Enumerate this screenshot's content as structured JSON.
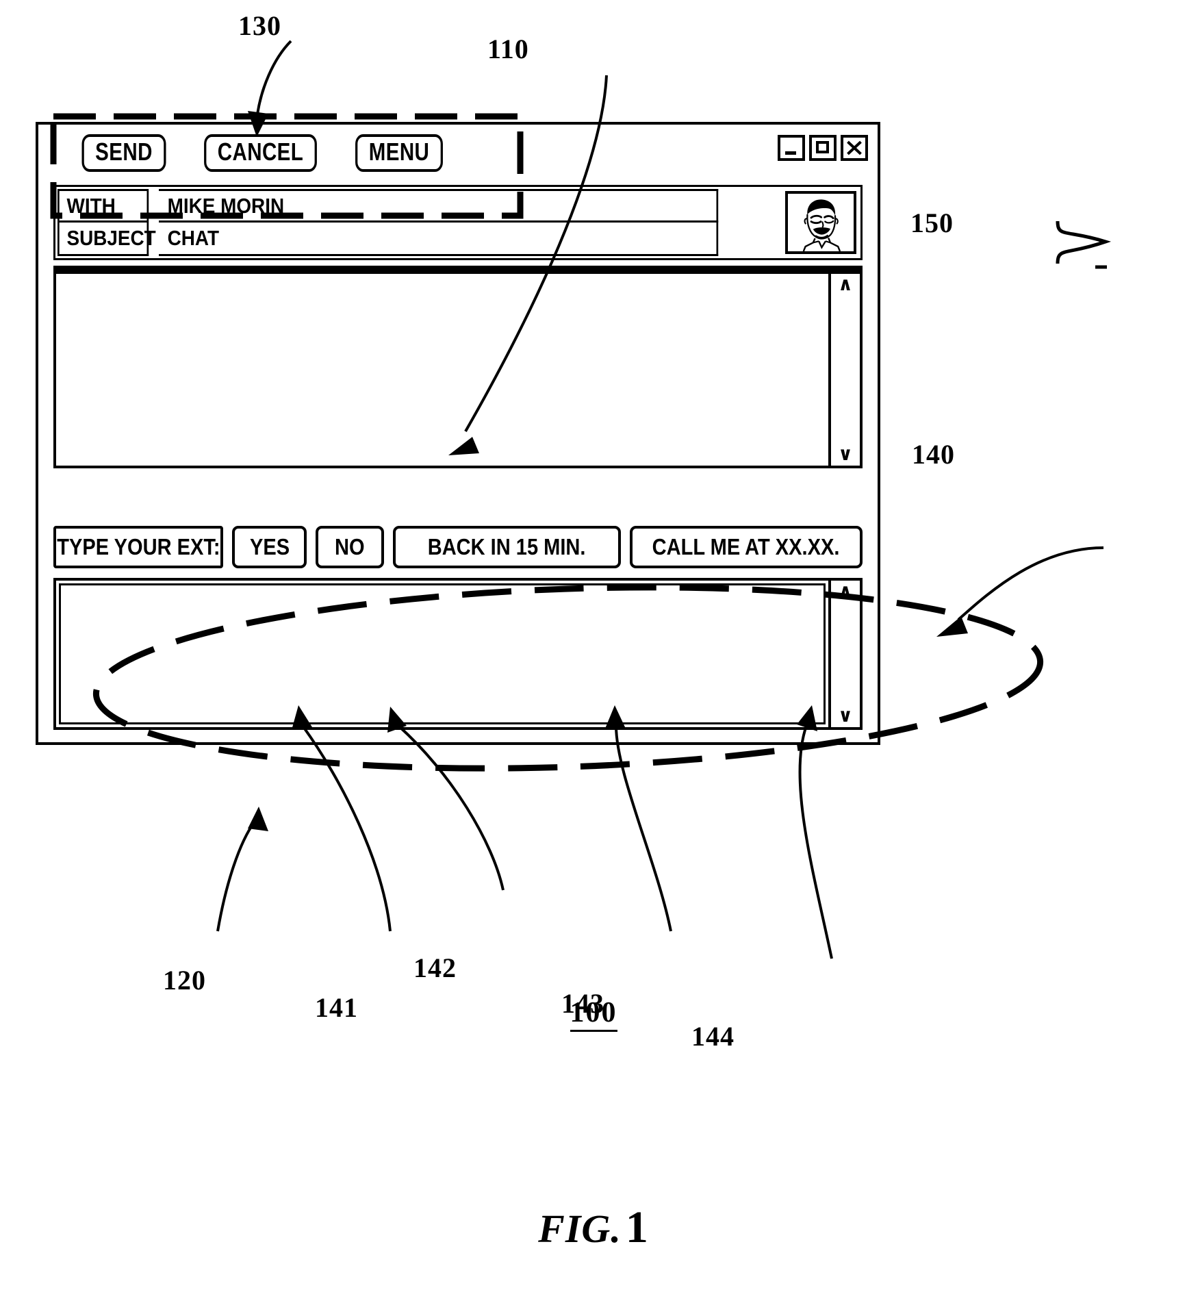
{
  "figure": {
    "caption_prefix": "FIG.",
    "caption_number": "1",
    "figure_id": "100"
  },
  "window": {
    "toolbar": {
      "send_label": "SEND",
      "cancel_label": "CANCEL",
      "menu_label": "MENU"
    },
    "window_controls": [
      {
        "name": "minimize",
        "glyph": "minimize-icon"
      },
      {
        "name": "maximize",
        "glyph": "maximize-icon"
      },
      {
        "name": "close",
        "glyph": "close-icon"
      }
    ],
    "header": {
      "with_label": "WITH",
      "with_value": "MIKE MORIN",
      "subject_label": "SUBJECT",
      "subject_value": "CHAT",
      "avatar_alt": "contact-portrait"
    },
    "history_pane": {
      "content": "",
      "scroll_up": "∧",
      "scroll_down": "∨"
    },
    "canned_responses": [
      {
        "label": "TYPE YOUR EXT:"
      },
      {
        "label": "YES"
      },
      {
        "label": "NO"
      },
      {
        "label": "BACK IN 15 MIN."
      },
      {
        "label": "CALL ME AT XX.XX."
      }
    ],
    "compose_pane": {
      "content": "",
      "scroll_up": "∧",
      "scroll_down": "∨"
    }
  },
  "reference_numerals": [
    {
      "id": "130",
      "text": "130",
      "describes": "toolbar-callout"
    },
    {
      "id": "110",
      "text": "110",
      "describes": "message-history-pane"
    },
    {
      "id": "150",
      "text": "150",
      "describes": "header-block"
    },
    {
      "id": "140",
      "text": "140",
      "describes": "canned-response-bar"
    },
    {
      "id": "120",
      "text": "120",
      "describes": "compose-pane"
    },
    {
      "id": "141",
      "text": "141",
      "describes": "yes-button"
    },
    {
      "id": "142",
      "text": "142",
      "describes": "no-button"
    },
    {
      "id": "143",
      "text": "143",
      "describes": "back-in-15-min-button"
    },
    {
      "id": "144",
      "text": "144",
      "describes": "call-me-at-button"
    }
  ],
  "colors": {
    "ink": "#000000",
    "paper": "#ffffff"
  }
}
